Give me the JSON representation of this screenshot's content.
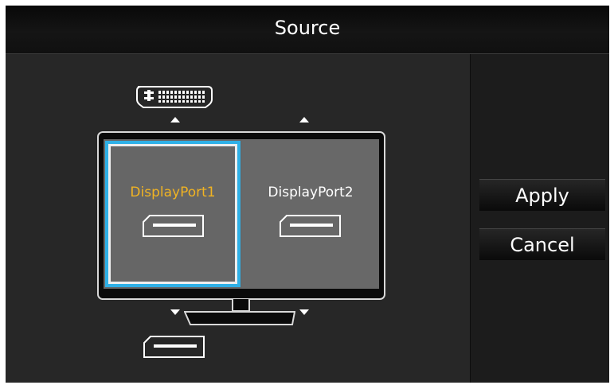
{
  "title": "Source",
  "ports": {
    "top_left": {
      "icon": "dvi-port-icon"
    },
    "bottom_left": {
      "icon": "displayport-icon"
    }
  },
  "panes": [
    {
      "label": "DisplayPort1",
      "icon": "displayport-icon",
      "selected": true
    },
    {
      "label": "DisplayPort2",
      "icon": "displayport-icon",
      "selected": false
    }
  ],
  "buttons": {
    "apply": "Apply",
    "cancel": "Cancel"
  },
  "colors": {
    "background": "#272727",
    "selection_outer": "#2fb0e6",
    "selected_label": "#f0b323",
    "text": "#ffffff"
  }
}
